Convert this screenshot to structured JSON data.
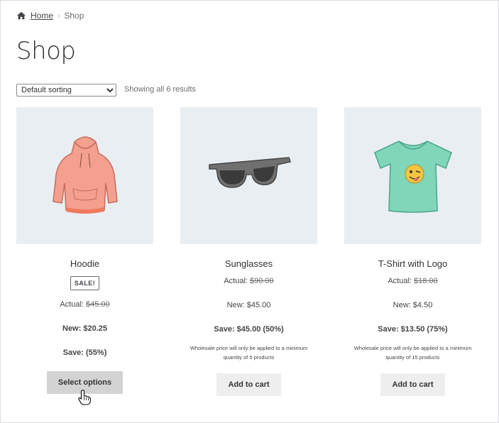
{
  "breadcrumb": {
    "home": "Home",
    "separator": "›",
    "current": "Shop"
  },
  "page": {
    "title": "Shop"
  },
  "sorting": {
    "selected": "Default sorting"
  },
  "result_count": "Showing all 6 results",
  "products": [
    {
      "name": "Hoodie",
      "badge": "SALE!",
      "actual_label": "Actual: ",
      "actual_price": "$45.00",
      "new_line": "New: $20.25",
      "save_line": "Save: (55%)",
      "button": "Select options"
    },
    {
      "name": "Sunglasses",
      "actual_label": "Actual: ",
      "actual_price": "$90.00",
      "new_line": "New: $45.00",
      "save_line": "Save: $45.00 (50%)",
      "note": "Wholesale price will only be applied to a minimum quantity of 5 products",
      "button": "Add to cart"
    },
    {
      "name": "T-Shirt with Logo",
      "actual_label": "Actual: ",
      "actual_price": "$18.00",
      "new_line": "New: $4.50",
      "save_line": "Save: $13.50 (75%)",
      "note": "Wholesale price will only be applied to a minimum quantity of 15 products",
      "button": "Add to cart"
    }
  ],
  "colors": {
    "hoodie": "#f3a08e",
    "sunglasses": "#707070",
    "tshirt": "#7fd6b8",
    "thumb_bg": "#e9eef2"
  },
  "icons": {
    "home": "home-icon",
    "cursor": "hand-pointer-icon"
  }
}
